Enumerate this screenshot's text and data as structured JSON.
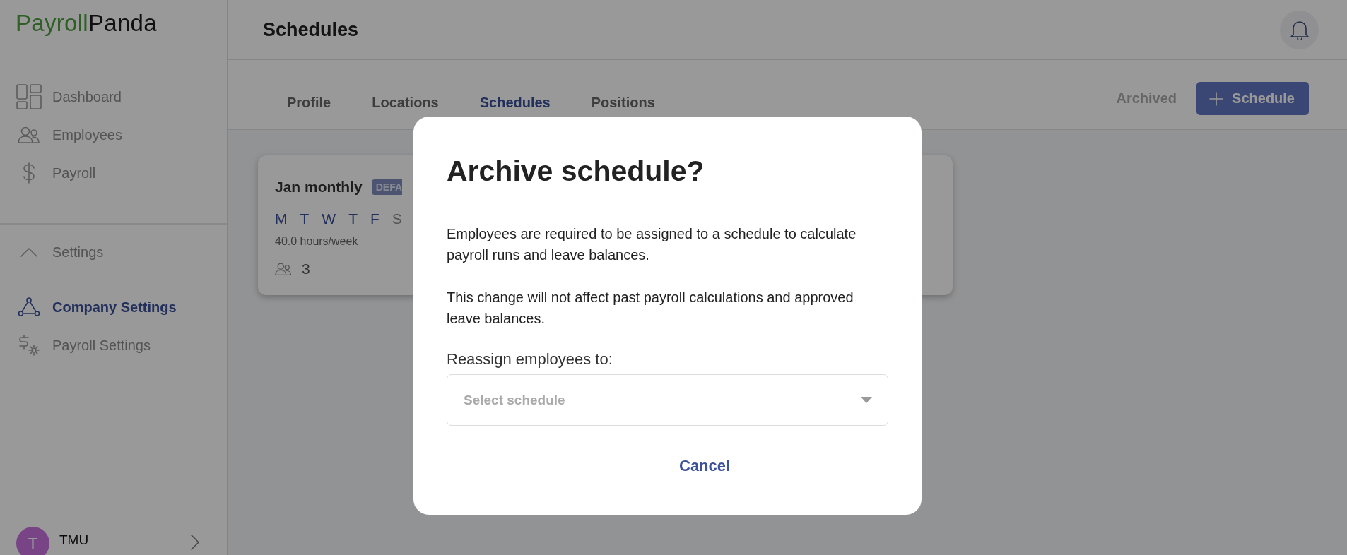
{
  "logo": {
    "first": "Payroll",
    "second": "Panda"
  },
  "nav": [
    {
      "kind": "dashboard",
      "label": "Dashboard",
      "selected": false
    },
    {
      "kind": "people",
      "label": "Employees",
      "selected": false
    },
    {
      "kind": "dollar",
      "label": "Payroll",
      "selected": false
    }
  ],
  "settings": {
    "label": "Settings",
    "expanded": true,
    "items": [
      {
        "kind": "company",
        "label": "Company Settings",
        "selected": true
      },
      {
        "kind": "payroll-settings",
        "label": "Payroll Settings",
        "selected": false
      }
    ]
  },
  "user": {
    "initial": "T",
    "name": "TMU"
  },
  "header": {
    "title": "Schedules"
  },
  "tabs": [
    {
      "label": "Profile",
      "selected": false
    },
    {
      "label": "Locations",
      "selected": false
    },
    {
      "label": "Schedules",
      "selected": true
    },
    {
      "label": "Positions",
      "selected": false
    }
  ],
  "actions": {
    "archived": "Archived",
    "add_button": "Schedule"
  },
  "schedule_cards": [
    {
      "title": "Jan monthly",
      "badge": "DEFA",
      "days": [
        {
          "label": "M",
          "active": true
        },
        {
          "label": "T",
          "active": true
        },
        {
          "label": "W",
          "active": true
        },
        {
          "label": "T",
          "active": true
        },
        {
          "label": "F",
          "active": true
        },
        {
          "label": "S",
          "active": false
        }
      ],
      "hours": "40.0 hours/week",
      "employee_count": "3"
    }
  ],
  "dialog": {
    "title": "Archive schedule?",
    "paragraphs": [
      "Employees are required to be assigned to a schedule to calculate payroll runs and leave balances.",
      "This change will not affect past payroll calculations and approved leave balances."
    ],
    "field_label": "Reassign employees to:",
    "select": {
      "placeholder": "Select schedule"
    },
    "cancel": "Cancel"
  }
}
